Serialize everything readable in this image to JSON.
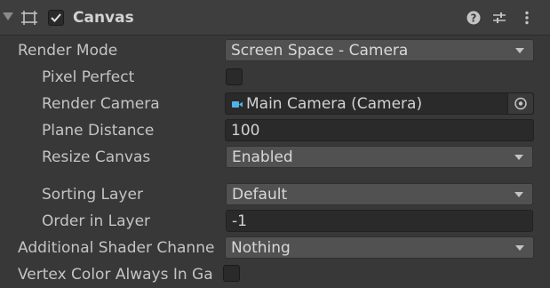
{
  "component": {
    "title": "Canvas",
    "enabled": true,
    "header_icons": [
      "help-icon",
      "presets-icon",
      "more-icon"
    ]
  },
  "properties": {
    "render_mode": {
      "label": "Render Mode",
      "value": "Screen Space - Camera"
    },
    "pixel_perfect": {
      "label": "Pixel Perfect",
      "checked": false
    },
    "render_camera": {
      "label": "Render Camera",
      "value": "Main Camera (Camera)"
    },
    "plane_distance": {
      "label": "Plane Distance",
      "value": "100"
    },
    "resize_canvas": {
      "label": "Resize Canvas",
      "value": "Enabled"
    },
    "sorting_layer": {
      "label": "Sorting Layer",
      "value": "Default"
    },
    "order_in_layer": {
      "label": "Order in Layer",
      "value": "-1"
    },
    "additional_shader_channels": {
      "label": "Additional Shader Channe",
      "value": "Nothing"
    },
    "vertex_color_gamma": {
      "label": "Vertex Color Always In Ga",
      "checked": false
    }
  },
  "colors": {
    "background": "#383838",
    "field": "#2a2a2a",
    "dropdown": "#515151",
    "camera_icon": "#4fb3e8"
  }
}
